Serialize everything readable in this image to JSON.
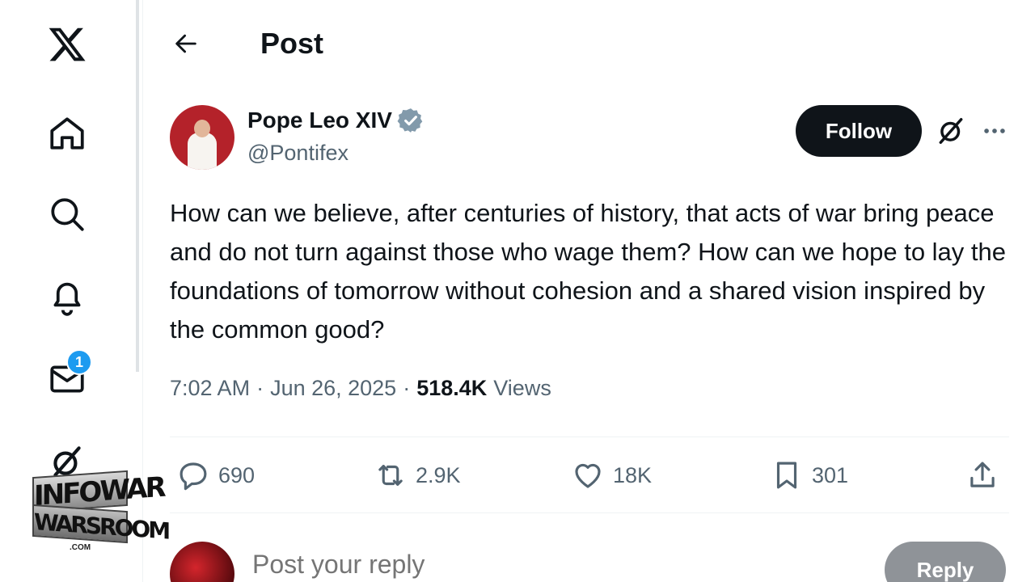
{
  "nav": {
    "items": [
      {
        "icon": "x-logo-icon"
      },
      {
        "icon": "home-icon"
      },
      {
        "icon": "search-icon"
      },
      {
        "icon": "bell-icon"
      },
      {
        "icon": "envelope-icon",
        "badge": "1"
      },
      {
        "icon": "grok-icon"
      }
    ]
  },
  "watermark": {
    "line1": "INFOWAR",
    "line2": "WARSROOM",
    "suffix": ".COM"
  },
  "header": {
    "title": "Post",
    "back_icon": "arrow-left-icon"
  },
  "post": {
    "author_name": "Pope Leo XIV",
    "handle": "@Pontifex",
    "verified_color": "#829aab",
    "follow_label": "Follow",
    "text": "How can we believe, after centuries of history, that acts of war bring peace and do not turn against those who wage them? How can we hope to lay the foundations of tomorrow without cohesion and a shared vision inspired by the common good?",
    "time": "7:02 AM",
    "date": "Jun 26, 2025",
    "views_count": "518.4K",
    "views_label": "Views",
    "separator": "·"
  },
  "actions": {
    "replies": "690",
    "reposts": "2.9K",
    "likes": "18K",
    "bookmarks": "301"
  },
  "composer": {
    "placeholder": "Post your reply",
    "reply_label": "Reply"
  },
  "colors": {
    "accent": "#1d9bf0",
    "text": "#0f1419",
    "muted": "#536471"
  }
}
